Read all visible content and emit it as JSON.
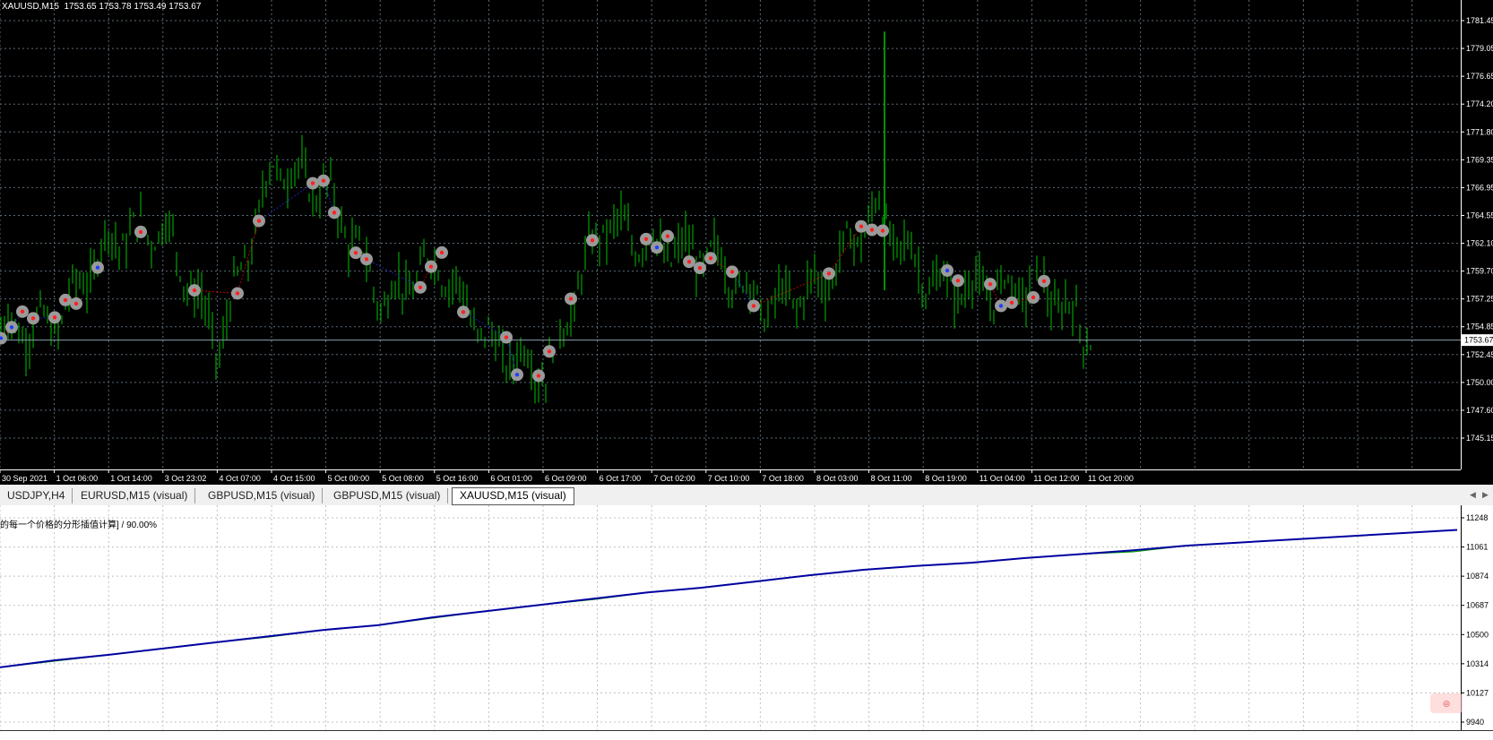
{
  "price_window": {
    "symbol_info": "XAUUSD,M15  1753.65 1753.78 1753.49 1753.67",
    "price_labels": [
      "1781.45",
      "1779.05",
      "1776.65",
      "1774.20",
      "1771.80",
      "1769.35",
      "1766.95",
      "1764.55",
      "1762.10",
      "1759.70",
      "1757.25",
      "1754.85",
      "1752.45",
      "1750.00",
      "1747.60",
      "1745.15"
    ],
    "current_price": "1753.67",
    "time_labels": [
      "30 Sep 2021",
      "1 Oct 06:00",
      "1 Oct 14:00",
      "3 Oct 23:02",
      "4 Oct 07:00",
      "4 Oct 15:00",
      "5 Oct 00:00",
      "5 Oct 08:00",
      "5 Oct 16:00",
      "6 Oct 01:00",
      "6 Oct 09:00",
      "6 Oct 17:00",
      "7 Oct 02:00",
      "7 Oct 10:00",
      "7 Oct 18:00",
      "8 Oct 03:00",
      "8 Oct 11:00",
      "8 Oct 19:00",
      "11 Oct 04:00",
      "11 Oct 12:00",
      "11 Oct 20:00"
    ],
    "colors": {
      "background": "#000000",
      "bars": "#00c000",
      "grid": "#5a6a78",
      "price_line": "#8aa0b0",
      "trade_marker": "#9a9a9a"
    }
  },
  "tabs": [
    {
      "label": "USDJPY,H4",
      "active": false
    },
    {
      "label": "EURUSD,M15 (visual)",
      "active": false
    },
    {
      "label": "GBPUSD,M15 (visual)",
      "active": false
    },
    {
      "label": "GBPUSD,M15 (visual)",
      "active": false
    },
    {
      "label": "XAUUSD,M15 (visual)",
      "active": true
    }
  ],
  "tab_scroll": {
    "left_icon": "arrow-left-icon",
    "right_icon": "arrow-right-icon"
  },
  "report_window": {
    "title": "的每一个价格的分形插值计算] / 90.00%",
    "axis_labels": [
      "11248",
      "11061",
      "10874",
      "10687",
      "10500",
      "10314",
      "10127",
      "9940"
    ],
    "colors": {
      "balance": "#0000a0",
      "equity": "#00a000",
      "grid": "#c0c0c0"
    },
    "watermark_icon": "app-logo-icon"
  },
  "chart_data": [
    {
      "type": "candlestick-bars",
      "title": "XAUUSD,M15",
      "ylim": [
        1745.15,
        1781.45
      ],
      "x": [
        "30 Sep 2021",
        "1 Oct 06:00",
        "1 Oct 14:00",
        "3 Oct 23:02",
        "4 Oct 07:00",
        "4 Oct 15:00",
        "5 Oct 00:00",
        "5 Oct 08:00",
        "5 Oct 16:00",
        "6 Oct 01:00",
        "6 Oct 09:00",
        "6 Oct 17:00",
        "7 Oct 02:00",
        "7 Oct 10:00",
        "7 Oct 18:00",
        "8 Oct 03:00",
        "8 Oct 11:00",
        "8 Oct 19:00",
        "11 Oct 04:00",
        "11 Oct 12:00",
        "11 Oct 20:00"
      ],
      "series": [
        {
          "values": [
            1754.5,
            1755.0,
            1762.5,
            1763.5,
            1753.0,
            1769.0,
            1766.5,
            1757.0,
            1760.5,
            1753.0,
            1751.0,
            1764.0,
            1761.5,
            1761.0,
            1756.5,
            1758.5,
            1765.0,
            1758.5,
            1758.0,
            1758.5,
            1753.7
          ]
        }
      ],
      "grid": true
    },
    {
      "type": "line",
      "ylim": [
        9940,
        11248
      ],
      "series": [
        {
          "name": "balance",
          "values": [
            10210,
            10255,
            10290,
            10330,
            10370,
            10410,
            10450,
            10480,
            10530,
            10570,
            10610,
            10650,
            10690,
            10720,
            10760,
            10800,
            10835,
            10860,
            10880,
            10910,
            10935,
            10960,
            10990,
            11010,
            11030,
            11050,
            11070,
            11090
          ]
        },
        {
          "name": "equity",
          "values": [
            10210,
            10250,
            10290,
            10330,
            10370,
            10405,
            10450,
            10480,
            10525,
            10570,
            10610,
            10645,
            10690,
            10720,
            10760,
            10800,
            10835,
            10860,
            10880,
            10910,
            10935,
            10950,
            10990,
            11010,
            11030,
            11050,
            11070,
            11090
          ]
        }
      ],
      "grid": true
    }
  ]
}
